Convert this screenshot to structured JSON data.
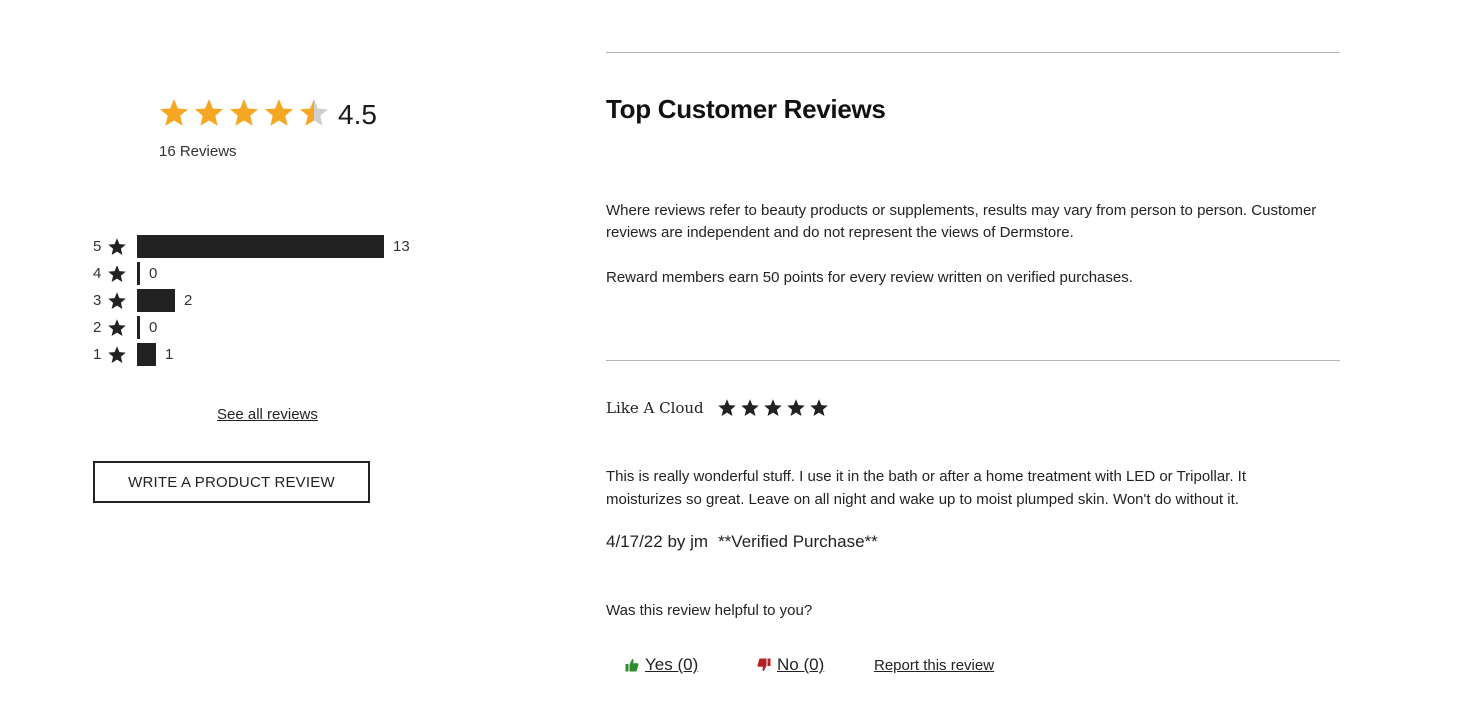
{
  "summary": {
    "rating_value": "4.5",
    "rating_stars": 4.5,
    "star_color": "#F5A623",
    "star_empty_color": "#CFCFCF",
    "review_count_label": "16 Reviews"
  },
  "histogram": [
    {
      "stars": "5",
      "count": 13
    },
    {
      "stars": "4",
      "count": 0
    },
    {
      "stars": "3",
      "count": 2
    },
    {
      "stars": "2",
      "count": 0
    },
    {
      "stars": "1",
      "count": 1
    }
  ],
  "histogram_bar_color": "#222222",
  "links": {
    "see_all": "See all reviews",
    "write_review": "WRITE A PRODUCT REVIEW"
  },
  "reviews_section": {
    "title": "Top Customer Reviews",
    "disclaimer": "Where reviews refer to beauty products or supplements, results may vary from person to person. Customer reviews are independent and do not represent the views of Dermstore.",
    "reward_note": "Reward members earn 50 points for every review written on verified purchases."
  },
  "review": {
    "title": "Like A Cloud",
    "stars": 5,
    "star_color": "#222222",
    "body": "This is really wonderful stuff. I use it in the bath or after a home treatment with LED or Tripollar. It moisturizes so great. Leave on all night and wake up to moist plumped skin. Won't do without it.",
    "date_author": "4/17/22 by jm",
    "verified": "**Verified Purchase**",
    "helpful_question": "Was this review helpful to you?",
    "yes_label": "Yes (0)",
    "no_label": "No (0)",
    "report_label": "Report this review",
    "yes_color": "#2E8B2E",
    "no_color": "#B22222"
  }
}
